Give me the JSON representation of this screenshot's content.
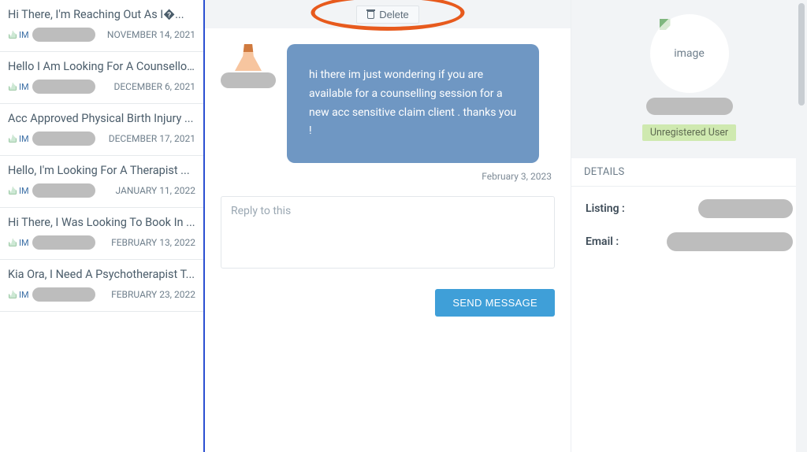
{
  "sidebar": {
    "conversations": [
      {
        "title": "Hi There, I'm Reaching Out As I�...",
        "date": "NOVEMBER 14, 2021"
      },
      {
        "title": "Hello I Am Looking For A Counsellor...",
        "date": "DECEMBER 6, 2021"
      },
      {
        "title": "Acc Approved Physical Birth Injury ...",
        "date": "DECEMBER 17, 2021"
      },
      {
        "title": "Hello, I'm Looking For A Therapist ...",
        "date": "JANUARY 11, 2022"
      },
      {
        "title": "Hi There, I Was Looking To Book In ...",
        "date": "FEBRUARY 13, 2022"
      },
      {
        "title": "Kia Ora, I Need A Psychotherapist T...",
        "date": "FEBRUARY 23, 2022"
      }
    ],
    "avatar_alt": "IM"
  },
  "toolbar": {
    "delete_label": "Delete"
  },
  "thread": {
    "message_text": "hi there im just wondering if you are available for a counselling session for a new acc sensitive claim client . thanks you !",
    "message_date": "February 3, 2023",
    "reply_placeholder": "Reply to this",
    "send_label": "SEND MESSAGE"
  },
  "right": {
    "image_label": "image",
    "status": "Unregistered User",
    "details_heading": "DETAILS",
    "listing_label": "Listing :",
    "email_label": "Email :"
  }
}
